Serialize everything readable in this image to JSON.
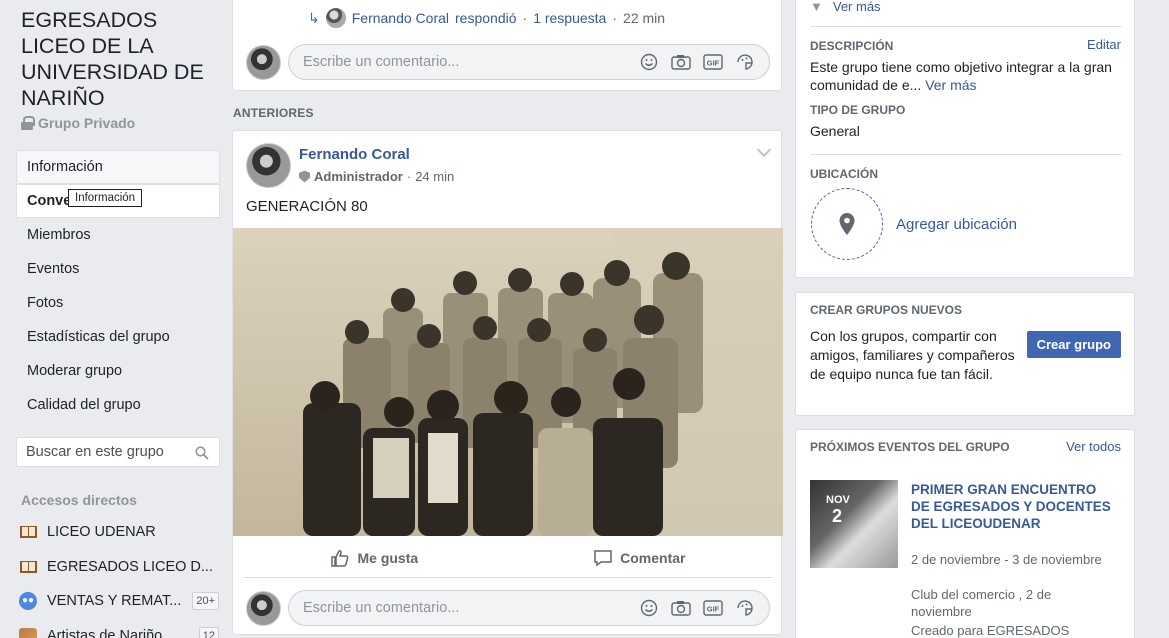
{
  "group": {
    "title": "EGRESADOS LICEO DE LA UNIVERSIDAD DE NARIÑO",
    "privacy": "Grupo Privado"
  },
  "nav": {
    "items": [
      "Información",
      "Conve",
      "Miembros",
      "Eventos",
      "Fotos",
      "Estadísticas del grupo",
      "Moderar grupo",
      "Calidad del grupo"
    ],
    "tooltip": "Información"
  },
  "search": {
    "placeholder": "Buscar en este grupo"
  },
  "shortcuts": {
    "title": "Accesos directos",
    "items": [
      {
        "label": "LICEO UDENAR",
        "badge": ""
      },
      {
        "label": "EGRESADOS LICEO D...",
        "badge": ""
      },
      {
        "label": "VENTAS Y REMAT...",
        "badge": "20+"
      },
      {
        "label": "Artistas de Nariño",
        "badge": "12"
      }
    ]
  },
  "top_post": {
    "reply_author": "Fernando Coral",
    "reply_text": "respondió",
    "reply_count": "1 respuesta",
    "reply_time": "22 min",
    "comment_placeholder": "Escribe un comentario..."
  },
  "feed": {
    "section_label": "ANTERIORES"
  },
  "post": {
    "author": "Fernando Coral",
    "role": "Administrador",
    "time": "24 min",
    "text": "GENERACIÓN 80",
    "like_label": "Me gusta",
    "comment_label": "Comentar",
    "comment_placeholder": "Escribe un comentario..."
  },
  "about": {
    "ver_mas_top": "Ver más",
    "desc_head": "DESCRIPCIÓN",
    "edit": "Editar",
    "desc_text": "Este grupo tiene como objetivo integrar a la gran comunidad de e...",
    "desc_more": "Ver más",
    "type_head": "TIPO DE GRUPO",
    "type_value": "General",
    "loc_head": "UBICACIÓN",
    "loc_link": "Agregar ubicación"
  },
  "create": {
    "head": "CREAR GRUPOS NUEVOS",
    "text": "Con los grupos, compartir con amigos, familiares y compañeros de equipo nunca fue tan fácil.",
    "button": "Crear grupo"
  },
  "events": {
    "head": "PRÓXIMOS EVENTOS DEL GRUPO",
    "see_all": "Ver todos",
    "month": "NOV",
    "day": "2",
    "title": "PRIMER GRAN ENCUENTRO DE EGRESADOS Y DOCENTES DEL LICEOUDENAR",
    "dates": "2 de noviembre - 3 de noviembre",
    "place": "Club del comercio , 2 de noviembre",
    "created_for": "Creado para EGRESADOS"
  },
  "colors": {
    "link": "#385898",
    "brand": "#4267b2",
    "background": "#e9ebee"
  }
}
